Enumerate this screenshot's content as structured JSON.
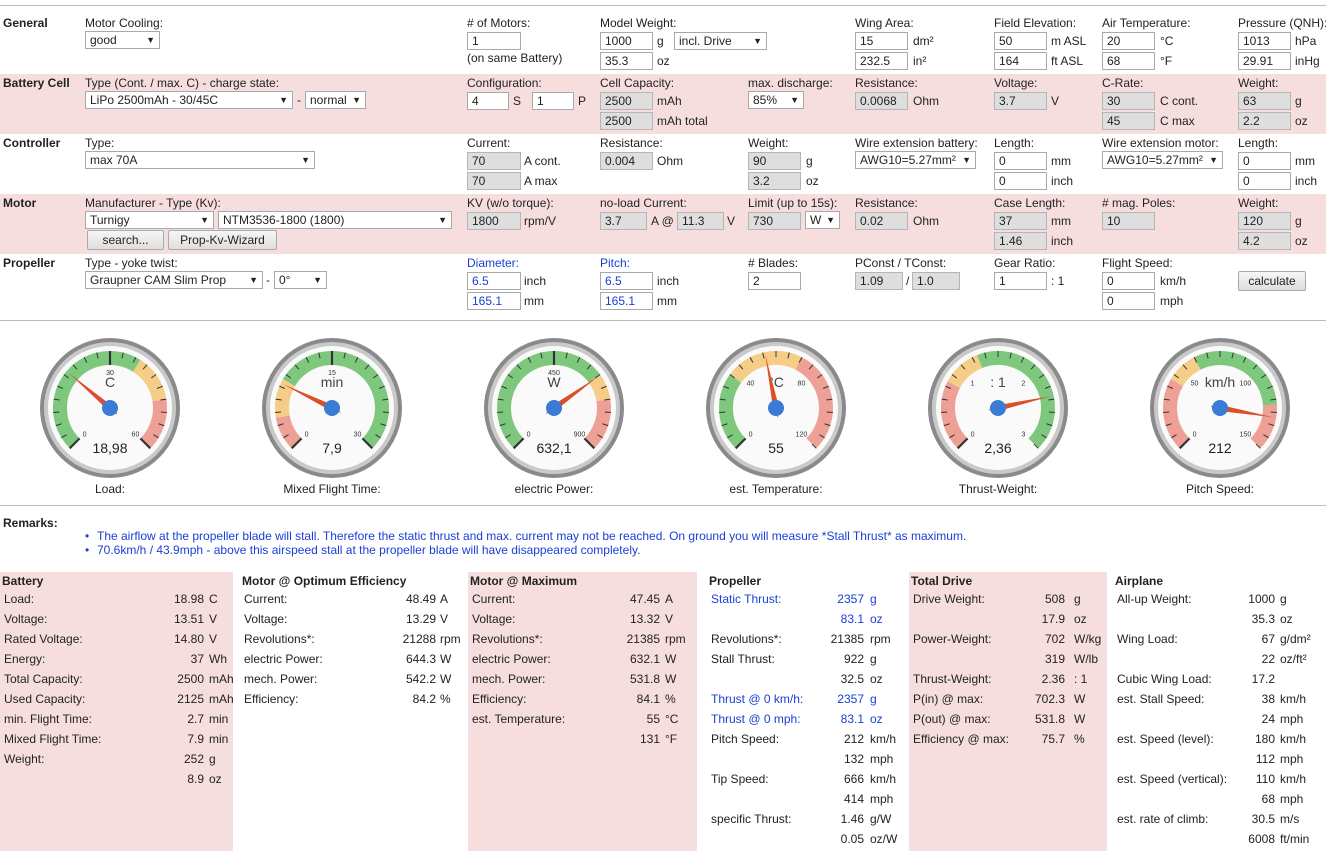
{
  "general": {
    "title": "General",
    "motor_cooling_label": "Motor Cooling:",
    "motor_cooling_value": "good",
    "motors_label": "# of Motors:",
    "motors_value": "1",
    "motors_note": "(on same Battery)",
    "model_weight_label": "Model Weight:",
    "model_weight_g": "1000",
    "model_weight_g_unit": "g",
    "model_weight_mode": "incl. Drive",
    "model_weight_oz": "35.3",
    "model_weight_oz_unit": "oz",
    "wing_area_label": "Wing Area:",
    "wing_area_dm": "15",
    "wing_area_dm_unit": "dm²",
    "wing_area_in": "232.5",
    "wing_area_in_unit": "in²",
    "field_elev_label": "Field Elevation:",
    "field_elev_m": "50",
    "field_elev_m_unit": "m ASL",
    "field_elev_ft": "164",
    "field_elev_ft_unit": "ft ASL",
    "air_temp_label": "Air Temperature:",
    "air_temp_c": "20",
    "air_temp_c_unit": "°C",
    "air_temp_f": "68",
    "air_temp_f_unit": "°F",
    "pressure_label": "Pressure (QNH):",
    "pressure_hpa": "1013",
    "pressure_hpa_unit": "hPa",
    "pressure_inhg": "29.91",
    "pressure_inhg_unit": "inHg"
  },
  "battery_cell": {
    "title": "Battery Cell",
    "type_label": "Type (Cont. / max. C) - charge state:",
    "type_value": "LiPo 2500mAh - 30/45C",
    "dash": "-",
    "charge_state": "normal",
    "config_label": "Configuration:",
    "config_s": "4",
    "config_s_unit": "S",
    "config_p": "1",
    "config_p_unit": "P",
    "capacity_label": "Cell Capacity:",
    "capacity": "2500",
    "capacity_unit": "mAh",
    "capacity_total": "2500",
    "capacity_total_unit": "mAh total",
    "max_discharge_label": "max. discharge:",
    "max_discharge": "85%",
    "resistance_label": "Resistance:",
    "resistance": "0.0068",
    "resistance_unit": "Ohm",
    "voltage_label": "Voltage:",
    "voltage": "3.7",
    "voltage_unit": "V",
    "crate_label": "C-Rate:",
    "c_cont": "30",
    "c_cont_unit": "C cont.",
    "c_max": "45",
    "c_max_unit": "C max",
    "weight_label": "Weight:",
    "weight_g": "63",
    "weight_g_unit": "g",
    "weight_oz": "2.2",
    "weight_oz_unit": "oz"
  },
  "controller": {
    "title": "Controller",
    "type_label": "Type:",
    "type_value": "max 70A",
    "current_label": "Current:",
    "current_cont": "70",
    "current_cont_unit": "A cont.",
    "current_max": "70",
    "current_max_unit": "A max",
    "resistance_label": "Resistance:",
    "resistance": "0.004",
    "resistance_unit": "Ohm",
    "weight_label": "Weight:",
    "weight_g": "90",
    "weight_g_unit": "g",
    "weight_oz": "3.2",
    "weight_oz_unit": "oz",
    "wire_batt_label": "Wire extension battery:",
    "wire_batt": "AWG10=5.27mm²",
    "len1_label": "Length:",
    "len1_mm": "0",
    "len1_mm_unit": "mm",
    "len1_inch": "0",
    "len1_inch_unit": "inch",
    "wire_motor_label": "Wire extension motor:",
    "wire_motor": "AWG10=5.27mm²",
    "len2_label": "Length:",
    "len2_mm": "0",
    "len2_mm_unit": "mm",
    "len2_inch": "0",
    "len2_inch_unit": "inch"
  },
  "motor": {
    "title": "Motor",
    "mfr_label": "Manufacturer - Type (Kv):",
    "manufacturer": "Turnigy",
    "model": "NTM3536-1800 (1800)",
    "search_btn": "search...",
    "wizard_btn": "Prop-Kv-Wizard",
    "kv_label": "KV (w/o torque):",
    "kv": "1800",
    "kv_unit": "rpm/V",
    "noload_label": "no-load Current:",
    "noload_a": "3.7",
    "noload_a_unit": "A @",
    "noload_v": "11.3",
    "noload_v_unit": "V",
    "limit_label": "Limit (up to 15s):",
    "limit": "730",
    "limit_unit": "W",
    "resistance_label": "Resistance:",
    "resistance": "0.02",
    "resistance_unit": "Ohm",
    "case_label": "Case Length:",
    "case_mm": "37",
    "case_mm_unit": "mm",
    "case_inch": "1.46",
    "case_inch_unit": "inch",
    "poles_label": "# mag. Poles:",
    "poles": "10",
    "weight_label": "Weight:",
    "weight_g": "120",
    "weight_g_unit": "g",
    "weight_oz": "4.2",
    "weight_oz_unit": "oz"
  },
  "propeller": {
    "title": "Propeller",
    "type_label": "Type - yoke twist:",
    "type_value": "Graupner CAM Slim Prop",
    "dash": "-",
    "twist": "0°",
    "diameter_label": "Diameter:",
    "diameter_in": "6.5",
    "diameter_in_unit": "inch",
    "diameter_mm": "165.1",
    "diameter_mm_unit": "mm",
    "pitch_label": "Pitch:",
    "pitch_in": "6.5",
    "pitch_in_unit": "inch",
    "pitch_mm": "165.1",
    "pitch_mm_unit": "mm",
    "blades_label": "# Blades:",
    "blades": "2",
    "pconst_label": "PConst / TConst:",
    "pconst": "1.09",
    "slash": "/",
    "tconst": "1.0",
    "gear_label": "Gear Ratio:",
    "gear": "1",
    "gear_unit": ": 1",
    "speed_label": "Flight Speed:",
    "speed_kmh": "0",
    "speed_kmh_unit": "km/h",
    "speed_mph": "0",
    "speed_mph_unit": "mph",
    "calculate_btn": "calculate"
  },
  "gauges": [
    {
      "unit": "C",
      "value": "18,98",
      "label": "Load:",
      "ticks": [
        "0",
        "30",
        "60"
      ],
      "fraction": 0.316
    },
    {
      "unit": "min",
      "value": "7,9",
      "label": "Mixed Flight Time:",
      "ticks": [
        "0",
        "15",
        "30"
      ],
      "fraction": 0.263
    },
    {
      "unit": "W",
      "value": "632,1",
      "label": "electric Power:",
      "ticks": [
        "0",
        "450",
        "900"
      ],
      "fraction": 0.702
    },
    {
      "unit": "°C",
      "value": "55",
      "label": "est. Temperature:",
      "ticks": [
        "0",
        "40",
        "80",
        "120"
      ],
      "fraction": 0.458
    },
    {
      "unit": ": 1",
      "value": "2,36",
      "label": "Thrust-Weight:",
      "ticks": [
        "0",
        "1",
        "2",
        "3"
      ],
      "fraction": 0.787
    },
    {
      "unit": "km/h",
      "value": "212",
      "label": "Pitch Speed:",
      "ticks": [
        "0",
        "50",
        "100",
        "150"
      ],
      "fraction": 0.87
    }
  ],
  "remarks": {
    "title": "Remarks:",
    "items": [
      "The airflow at the propeller blade will stall. Therefore the static thrust and max. current may not be reached. On ground you will measure *Stall Thrust* as maximum.",
      "70.6km/h / 43.9mph - above this airspeed stall at the propeller blade will have disappeared completely."
    ]
  },
  "results": {
    "battery": {
      "title": "Battery",
      "rows": [
        {
          "label": "Load:",
          "value": "18.98",
          "unit": "C"
        },
        {
          "label": "Voltage:",
          "value": "13.51",
          "unit": "V"
        },
        {
          "label": "Rated Voltage:",
          "value": "14.80",
          "unit": "V"
        },
        {
          "label": "Energy:",
          "value": "37",
          "unit": "Wh"
        },
        {
          "label": "Total Capacity:",
          "value": "2500",
          "unit": "mAh"
        },
        {
          "label": "Used Capacity:",
          "value": "2125",
          "unit": "mAh"
        },
        {
          "label": "min. Flight Time:",
          "value": "2.7",
          "unit": "min"
        },
        {
          "label": "Mixed Flight Time:",
          "value": "7.9",
          "unit": "min"
        },
        {
          "label": "Weight:",
          "value": "252",
          "unit": "g"
        },
        {
          "label": "",
          "value": "8.9",
          "unit": "oz"
        }
      ]
    },
    "opt": {
      "title": "Motor @ Optimum Efficiency",
      "rows": [
        {
          "label": "Current:",
          "value": "48.49",
          "unit": "A"
        },
        {
          "label": "Voltage:",
          "value": "13.29",
          "unit": "V"
        },
        {
          "label": "Revolutions*:",
          "value": "21288",
          "unit": "rpm"
        },
        {
          "label": "electric Power:",
          "value": "644.3",
          "unit": "W"
        },
        {
          "label": "mech. Power:",
          "value": "542.2",
          "unit": "W"
        },
        {
          "label": "Efficiency:",
          "value": "84.2",
          "unit": "%"
        }
      ]
    },
    "max": {
      "title": "Motor @ Maximum",
      "rows": [
        {
          "label": "Current:",
          "value": "47.45",
          "unit": "A"
        },
        {
          "label": "Voltage:",
          "value": "13.32",
          "unit": "V"
        },
        {
          "label": "Revolutions*:",
          "value": "21385",
          "unit": "rpm"
        },
        {
          "label": "electric Power:",
          "value": "632.1",
          "unit": "W"
        },
        {
          "label": "mech. Power:",
          "value": "531.8",
          "unit": "W"
        },
        {
          "label": "Efficiency:",
          "value": "84.1",
          "unit": "%"
        },
        {
          "label": "est. Temperature:",
          "value": "55",
          "unit": "°C"
        },
        {
          "label": "",
          "value": "131",
          "unit": "°F"
        }
      ]
    },
    "prop": {
      "title": "Propeller",
      "rows": [
        {
          "label": "Static Thrust:",
          "value": "2357",
          "unit": "g",
          "blue": true
        },
        {
          "label": "",
          "value": "83.1",
          "unit": "oz",
          "blue": true
        },
        {
          "label": "Revolutions*:",
          "value": "21385",
          "unit": "rpm"
        },
        {
          "label": "Stall Thrust:",
          "value": "922",
          "unit": "g"
        },
        {
          "label": "",
          "value": "32.5",
          "unit": "oz"
        },
        {
          "label": "Thrust @ 0 km/h:",
          "value": "2357",
          "unit": "g",
          "blue": true
        },
        {
          "label": "Thrust @ 0 mph:",
          "value": "83.1",
          "unit": "oz",
          "blue": true
        },
        {
          "label": "Pitch Speed:",
          "value": "212",
          "unit": "km/h"
        },
        {
          "label": "",
          "value": "132",
          "unit": "mph"
        },
        {
          "label": "Tip Speed:",
          "value": "666",
          "unit": "km/h"
        },
        {
          "label": "",
          "value": "414",
          "unit": "mph"
        },
        {
          "label": "specific Thrust:",
          "value": "1.46",
          "unit": "g/W"
        },
        {
          "label": "",
          "value": "0.05",
          "unit": "oz/W"
        }
      ]
    },
    "drive": {
      "title": "Total Drive",
      "rows": [
        {
          "label": "Drive Weight:",
          "value": "508",
          "unit": "g"
        },
        {
          "label": "",
          "value": "17.9",
          "unit": "oz"
        },
        {
          "label": "Power-Weight:",
          "value": "702",
          "unit": "W/kg"
        },
        {
          "label": "",
          "value": "319",
          "unit": "W/lb"
        },
        {
          "label": "Thrust-Weight:",
          "value": "2.36",
          "unit": ": 1"
        },
        {
          "label": "P(in) @ max:",
          "value": "702.3",
          "unit": "W"
        },
        {
          "label": "P(out) @ max:",
          "value": "531.8",
          "unit": "W"
        },
        {
          "label": "Efficiency @ max:",
          "value": "75.7",
          "unit": "%"
        }
      ]
    },
    "plane": {
      "title": "Airplane",
      "rows": [
        {
          "label": "All-up Weight:",
          "value": "1000",
          "unit": "g"
        },
        {
          "label": "",
          "value": "35.3",
          "unit": "oz"
        },
        {
          "label": "Wing Load:",
          "value": "67",
          "unit": "g/dm²"
        },
        {
          "label": "",
          "value": "22",
          "unit": "oz/ft²"
        },
        {
          "label": "Cubic Wing Load:",
          "value": "17.2",
          "unit": ""
        },
        {
          "label": "est. Stall Speed:",
          "value": "38",
          "unit": "km/h"
        },
        {
          "label": "",
          "value": "24",
          "unit": "mph"
        },
        {
          "label": "est. Speed (level):",
          "value": "180",
          "unit": "km/h"
        },
        {
          "label": "",
          "value": "112",
          "unit": "mph"
        },
        {
          "label": "est. Speed (vertical):",
          "value": "110",
          "unit": "km/h"
        },
        {
          "label": "",
          "value": "68",
          "unit": "mph"
        },
        {
          "label": "est. rate of climb:",
          "value": "30.5",
          "unit": "m/s"
        },
        {
          "label": "",
          "value": "6008",
          "unit": "ft/min"
        }
      ]
    }
  }
}
